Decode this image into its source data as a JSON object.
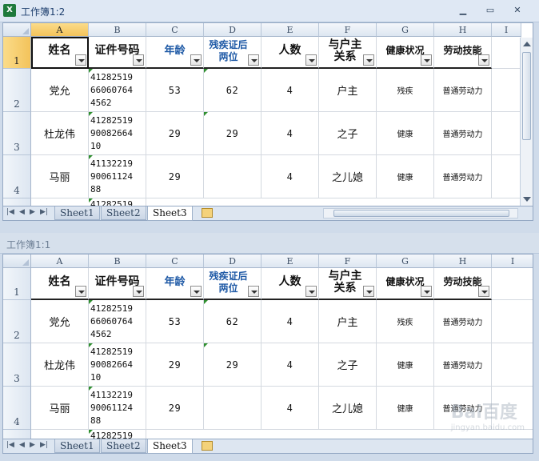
{
  "windows": [
    {
      "title": "工作簿1:2",
      "show_controls": true,
      "selected_col": "A",
      "selected_row": "1",
      "tabs": [
        "Sheet1",
        "Sheet2",
        "Sheet3"
      ],
      "active_tab": "Sheet3"
    },
    {
      "title": "工作簿1:1",
      "show_controls": false,
      "tabs": [
        "Sheet1",
        "Sheet2",
        "Sheet3"
      ],
      "active_tab": "Sheet3"
    }
  ],
  "window_controls": {
    "minimize": "▁",
    "restore": "▭",
    "close": "✕"
  },
  "columns": [
    "A",
    "B",
    "C",
    "D",
    "E",
    "F",
    "G",
    "H",
    "I"
  ],
  "rows": [
    "1",
    "2",
    "3",
    "4"
  ],
  "headers": [
    "姓名",
    "证件号码",
    "年龄",
    "残疾证后两位",
    "人数",
    "与户主关系",
    "健康状况",
    "劳动技能"
  ],
  "records": [
    {
      "name": "党允",
      "id": "41282519\n66060764\n4562",
      "age": "53",
      "disab": "62",
      "count": "4",
      "rel": "户主",
      "health": "残疾",
      "skill": "普通劳动力"
    },
    {
      "name": "杜龙伟",
      "id": "41282519\n90082664\n10",
      "age": "29",
      "disab": "29",
      "count": "4",
      "rel": "之子",
      "health": "健康",
      "skill": "普通劳动力"
    },
    {
      "name": "马丽",
      "id": "41132219\n90061124\n88",
      "age": "29",
      "disab": "",
      "count": "4",
      "rel": "之儿媳",
      "health": "健康",
      "skill": "普通劳动力"
    }
  ],
  "partial_row_id": "41282519",
  "watermark": {
    "brand": "Bai百度",
    "site": "jingyan.baidu.com"
  }
}
